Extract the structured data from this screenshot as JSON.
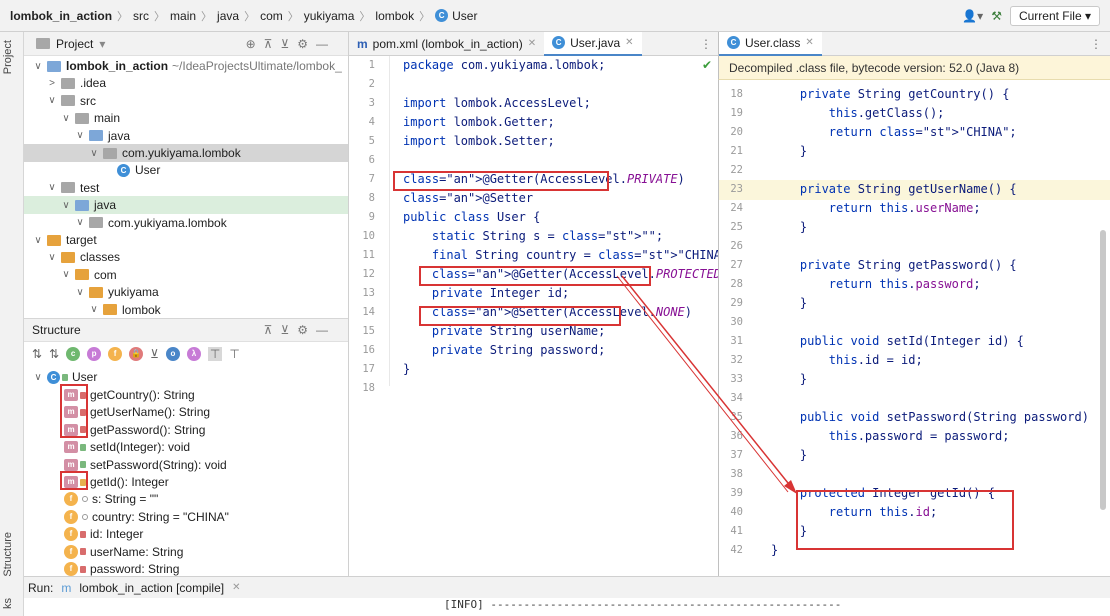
{
  "breadcrumb": [
    "lombok_in_action",
    "src",
    "main",
    "java",
    "com",
    "yukiyama",
    "lombok",
    "User"
  ],
  "toolbar": {
    "current_file": "Current File"
  },
  "side_labels": {
    "project": "Project",
    "structure": "Structure",
    "bottom": "ks"
  },
  "project_panel": {
    "title": "Project",
    "rows": [
      {
        "label": "lombok_in_action",
        "suffix": "~/IdeaProjectsUltimate/lombok_",
        "indent": 0,
        "arrow": "∨",
        "icon": "module"
      },
      {
        "label": ".idea",
        "indent": 1,
        "arrow": ">",
        "icon": "folder"
      },
      {
        "label": "src",
        "indent": 1,
        "arrow": "∨",
        "icon": "folder"
      },
      {
        "label": "main",
        "indent": 2,
        "arrow": "∨",
        "icon": "folder"
      },
      {
        "label": "java",
        "indent": 3,
        "arrow": "∨",
        "icon": "folder-blue"
      },
      {
        "label": "com.yukiyama.lombok",
        "indent": 4,
        "arrow": "∨",
        "icon": "package"
      },
      {
        "label": "User",
        "indent": 5,
        "arrow": "",
        "icon": "class"
      },
      {
        "label": "test",
        "indent": 1,
        "arrow": "∨",
        "icon": "folder"
      },
      {
        "label": "java",
        "indent": 2,
        "arrow": "∨",
        "icon": "folder-green"
      },
      {
        "label": "com.yukiyama.lombok",
        "indent": 3,
        "arrow": "∨",
        "icon": "package"
      },
      {
        "label": "target",
        "indent": 0,
        "arrow": "∨",
        "icon": "folder-orange"
      },
      {
        "label": "classes",
        "indent": 1,
        "arrow": "∨",
        "icon": "folder-orange"
      },
      {
        "label": "com",
        "indent": 2,
        "arrow": "∨",
        "icon": "folder-orange"
      },
      {
        "label": "yukiyama",
        "indent": 3,
        "arrow": "∨",
        "icon": "folder-orange"
      },
      {
        "label": "lombok",
        "indent": 4,
        "arrow": "∨",
        "icon": "folder-orange"
      }
    ]
  },
  "structure_panel": {
    "title": "Structure",
    "root": "User",
    "items": [
      {
        "label": "getCountry(): String",
        "kind": "m",
        "access": "private"
      },
      {
        "label": "getUserName(): String",
        "kind": "m",
        "access": "private"
      },
      {
        "label": "getPassword(): String",
        "kind": "m",
        "access": "private"
      },
      {
        "label": "setId(Integer): void",
        "kind": "m",
        "access": "public"
      },
      {
        "label": "setPassword(String): void",
        "kind": "m",
        "access": "public"
      },
      {
        "label": "getId(): Integer",
        "kind": "m",
        "access": "protected"
      },
      {
        "label": "s: String = \"\"",
        "kind": "f",
        "access": "package"
      },
      {
        "label": "country: String = \"CHINA\"",
        "kind": "f",
        "access": "package"
      },
      {
        "label": "id: Integer",
        "kind": "f",
        "access": "private"
      },
      {
        "label": "userName: String",
        "kind": "f",
        "access": "private"
      },
      {
        "label": "password: String",
        "kind": "f",
        "access": "private"
      }
    ]
  },
  "run_bar": {
    "label": "Run:",
    "tab": "lombok_in_action [compile]",
    "output": "[INFO] -----------------------------------------------------"
  },
  "editor_left": {
    "tabs": [
      "pom.xml (lombok_in_action)",
      "User.java"
    ],
    "line_numbers": [
      "1",
      "2",
      "3",
      "4",
      "5",
      "6",
      "7",
      "8",
      "9",
      "10",
      "11",
      "12",
      "13",
      "14",
      "15",
      "16",
      "17",
      "18"
    ],
    "lines": [
      "package com.yukiyama.lombok;",
      "",
      "import lombok.AccessLevel;",
      "import lombok.Getter;",
      "import lombok.Setter;",
      "",
      "@Getter(AccessLevel.PRIVATE)",
      "@Setter",
      "public class User {",
      "    static String s = \"\";",
      "    final String country = \"CHINA\";",
      "    @Getter(AccessLevel.PROTECTED)",
      "    private Integer id;",
      "    @Setter(AccessLevel.NONE)",
      "    private String userName;",
      "    private String password;",
      "}",
      ""
    ]
  },
  "editor_right": {
    "tab": "User.class",
    "banner": "Decompiled .class file, bytecode version: 52.0 (Java 8)",
    "line_numbers": [
      "18",
      "19",
      "20",
      "21",
      "22",
      "23",
      "24",
      "25",
      "26",
      "27",
      "28",
      "29",
      "30",
      "31",
      "32",
      "33",
      "34",
      "35",
      "36",
      "37",
      "38",
      "39",
      "40",
      "41",
      "42"
    ],
    "lines": [
      "    private String getCountry() {",
      "        this.getClass();",
      "        return \"CHINA\";",
      "    }",
      "",
      "    private String getUserName() {",
      "        return this.userName;",
      "    }",
      "",
      "    private String getPassword() {",
      "        return this.password;",
      "    }",
      "",
      "    public void setId(Integer id) {",
      "        this.id = id;",
      "    }",
      "",
      "    public void setPassword(String password)",
      "        this.password = password;",
      "    }",
      "",
      "    protected Integer getId() {",
      "        return this.id;",
      "    }",
      "}"
    ]
  },
  "colors": {
    "annotation": "#9e880d",
    "keyword": "#0033b3",
    "string": "#067d17",
    "field": "#871094",
    "highlight_box": "#d83434"
  }
}
